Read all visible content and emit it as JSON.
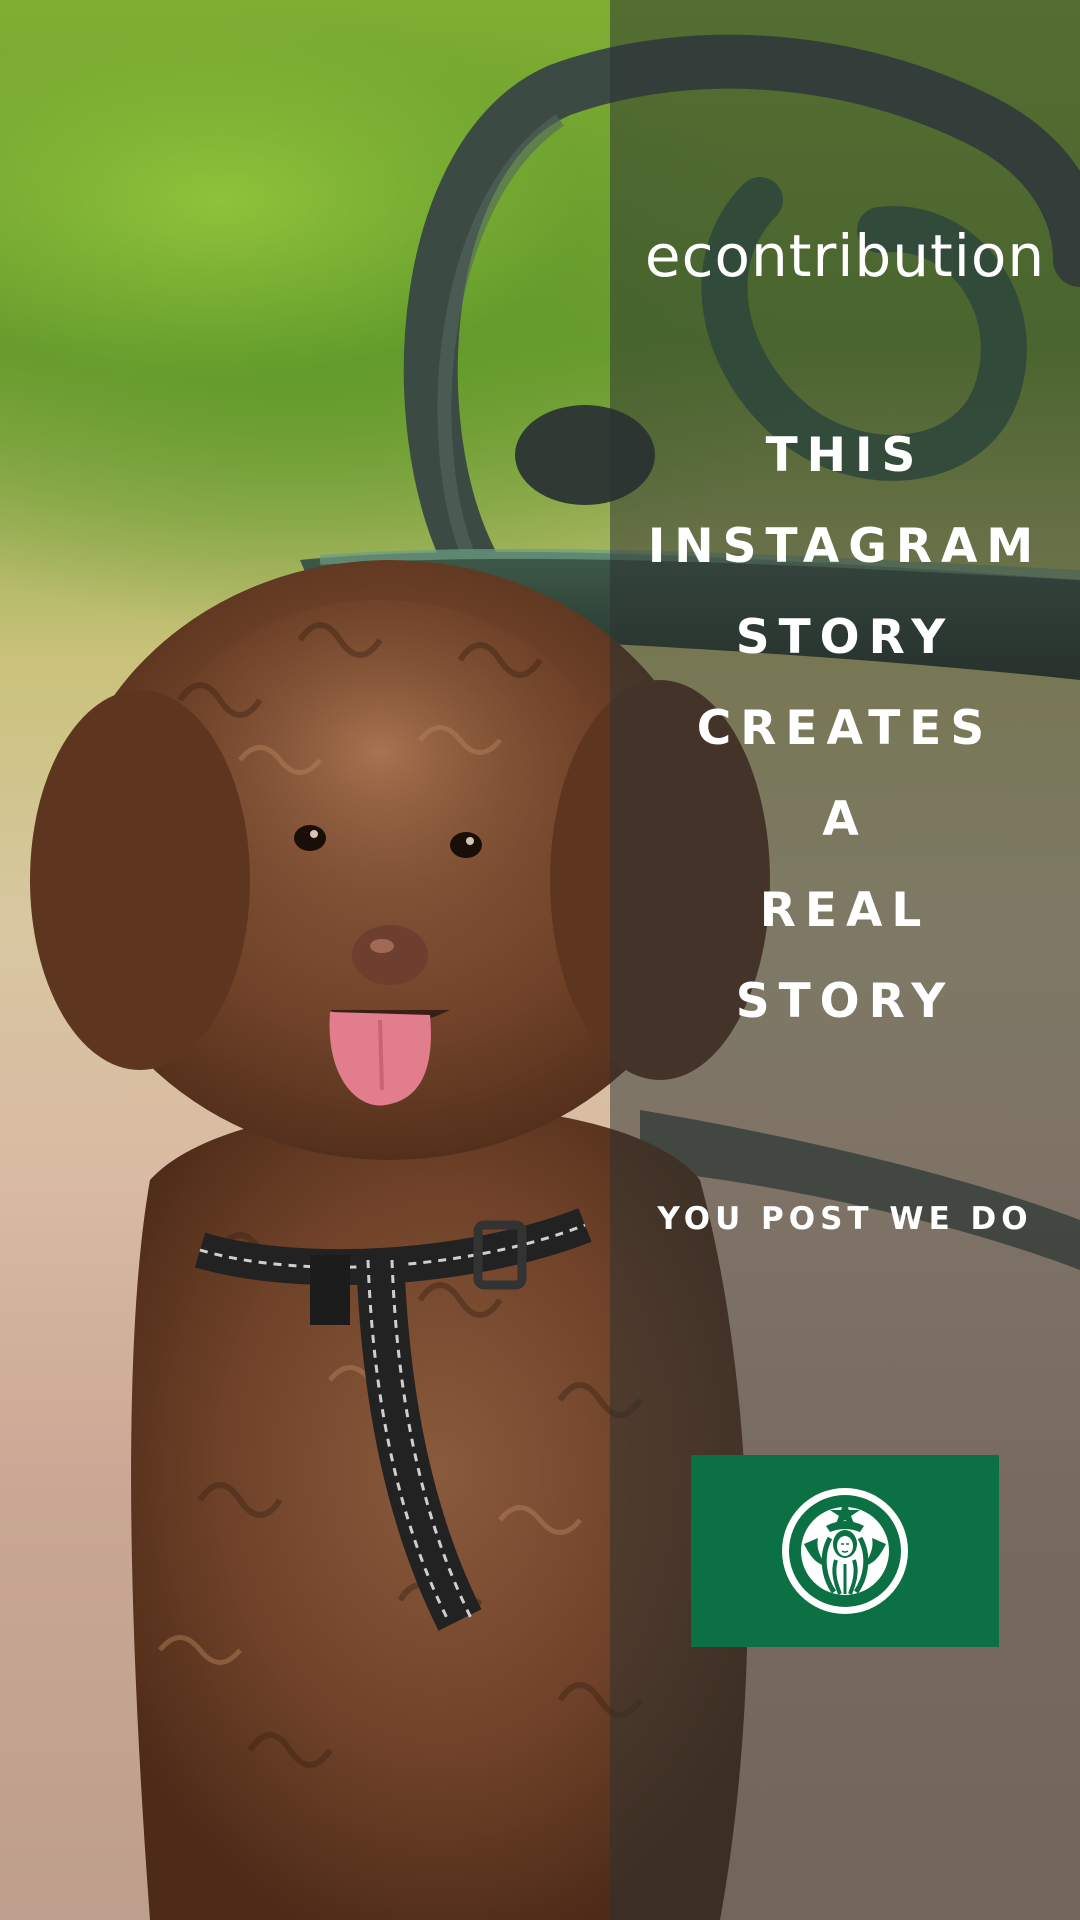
{
  "story": {
    "brand_name": "econtribution",
    "headline_lines": [
      "THIS",
      "INSTAGRAM",
      "STORY",
      "CREATES",
      "A",
      "REAL",
      "STORY"
    ],
    "tagline": "YOU POST WE DO",
    "sponsor_logo": "starbucks-siren-logo",
    "logo_background_color": "#0b7044",
    "overlay_color": "#2d3230"
  }
}
